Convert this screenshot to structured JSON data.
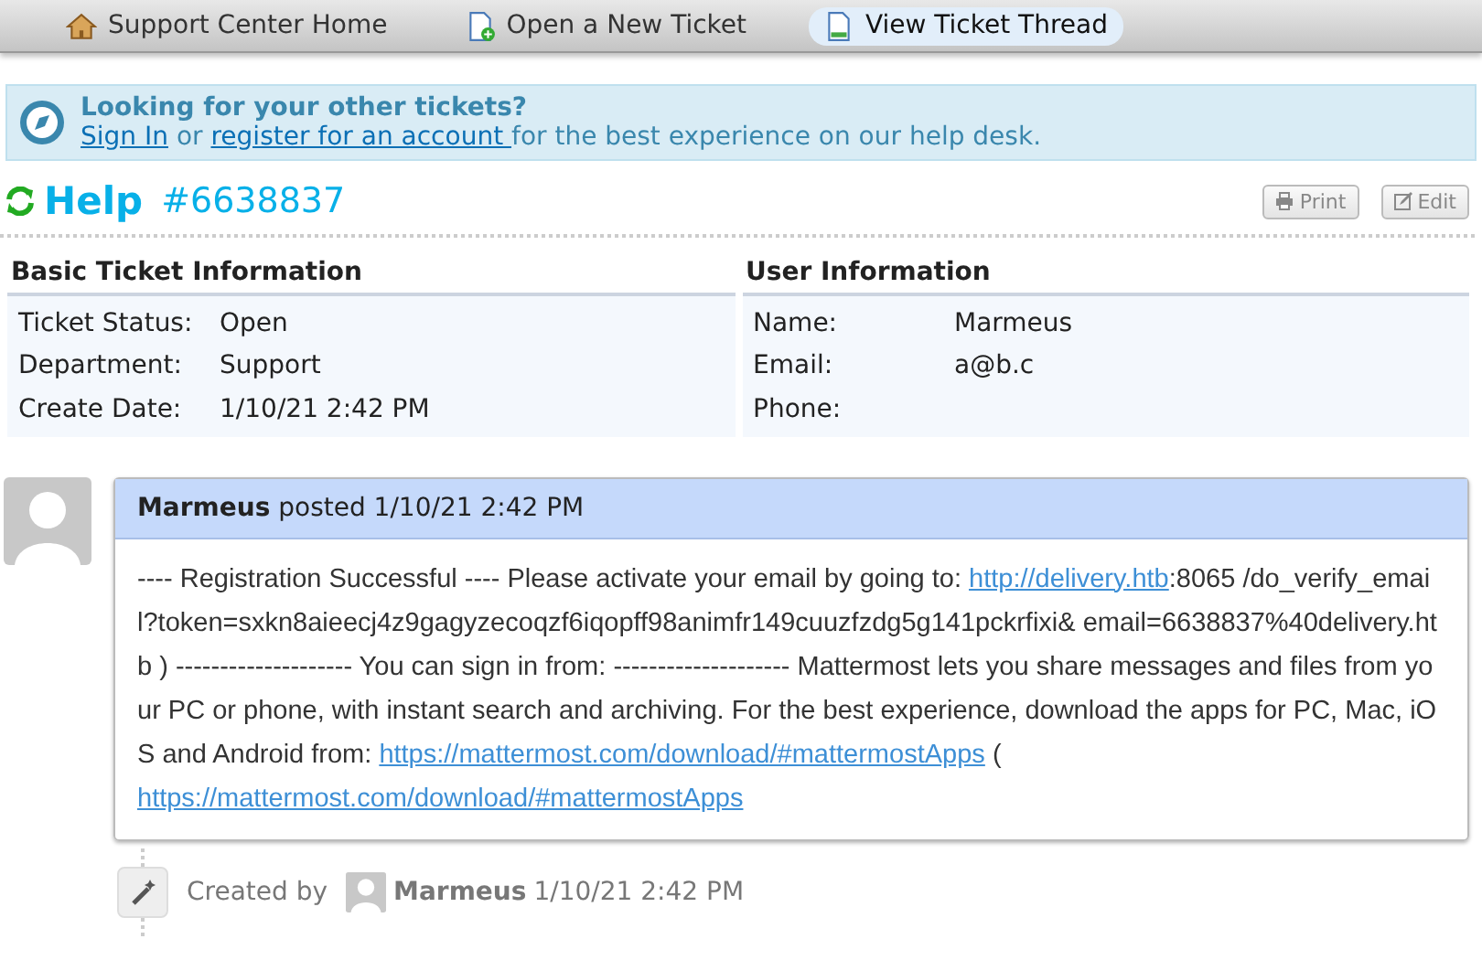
{
  "nav": [
    {
      "label": "Support Center Home",
      "kind": "home",
      "selected": false
    },
    {
      "label": "Open a New Ticket",
      "kind": "new",
      "selected": false
    },
    {
      "label": "View Ticket Thread",
      "kind": "view",
      "selected": true
    }
  ],
  "banner": {
    "title": "Looking for your other tickets?",
    "segments": [
      {
        "kind": "link",
        "text": "Sign In"
      },
      {
        "kind": "text",
        "text": " or "
      },
      {
        "kind": "link",
        "text": "register for an account "
      },
      {
        "kind": "text",
        "text": "for the best experience on our help desk."
      }
    ]
  },
  "ticket": {
    "subject": "Help",
    "number": "#6638837",
    "buttons": [
      {
        "label": "Print",
        "kind": "print"
      },
      {
        "label": "Edit",
        "kind": "edit"
      }
    ]
  },
  "panels": [
    {
      "title": "Basic Ticket Information",
      "rows": [
        {
          "label": "Ticket Status:",
          "value": "Open"
        },
        {
          "label": "Department:",
          "value": "Support"
        },
        {
          "label": "Create Date:",
          "value": "1/10/21 2:42 PM"
        }
      ]
    },
    {
      "title": "User Information",
      "rows": [
        {
          "label": "Name:",
          "value": "Marmeus"
        },
        {
          "label": "Email:",
          "value": "a@b.c"
        },
        {
          "label": "Phone:",
          "value": ""
        }
      ]
    }
  ],
  "thread": {
    "author": "Marmeus",
    "posted": "posted 1/10/21 2:42 PM",
    "body": [
      {
        "kind": "text",
        "text": "---- Registration Successful ---- Please activate your email by going to: "
      },
      {
        "kind": "link",
        "text": "http://delivery.htb"
      },
      {
        "kind": "text",
        "text": ":8065 /do_verify_email?token=sxkn8aieecj4z9gagyzecoqzf6iqopff98animfr149cuuzfzdg5g141pckrfixi& email=6638837%40delivery.htb ) -------------------- You can sign in from: -------------------- Mattermost lets you share messages and files from your PC or phone, with instant search and archiving. For the best experience, download the apps for PC, Mac, iOS and Android from: "
      },
      {
        "kind": "link",
        "text": "https://mattermost.com/download/#mattermostApps"
      },
      {
        "kind": "text",
        "text": " ( "
      },
      {
        "kind": "link",
        "text": "https://mattermost.com/download/#mattermostApps"
      }
    ]
  },
  "event": {
    "prefix": "Created by",
    "author": "Marmeus",
    "time": "1/10/21 2:42 PM"
  }
}
